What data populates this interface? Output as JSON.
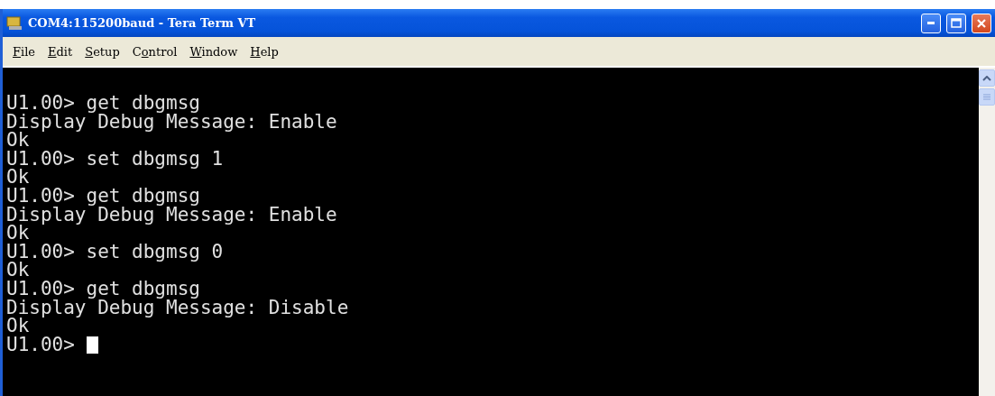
{
  "window": {
    "title": "COM4:115200baud - Tera Term VT"
  },
  "menu": [
    {
      "accel": "F",
      "rest": "ile"
    },
    {
      "accel": "E",
      "rest": "dit"
    },
    {
      "accel": "S",
      "rest": "etup"
    },
    {
      "lead": "C",
      "accel": "o",
      "rest": "ntrol"
    },
    {
      "accel": "W",
      "rest": "indow"
    },
    {
      "accel": "H",
      "rest": "elp"
    }
  ],
  "terminal": {
    "lines": [
      "U1.00> get dbgmsg",
      "Display Debug Message: Enable",
      "Ok",
      "U1.00> set dbgmsg 1",
      "Ok",
      "U1.00> get dbgmsg",
      "Display Debug Message: Enable",
      "Ok",
      "U1.00> set dbgmsg 0",
      "Ok",
      "U1.00> get dbgmsg",
      "Display Debug Message: Disable",
      "Ok",
      "U1.00> "
    ]
  }
}
